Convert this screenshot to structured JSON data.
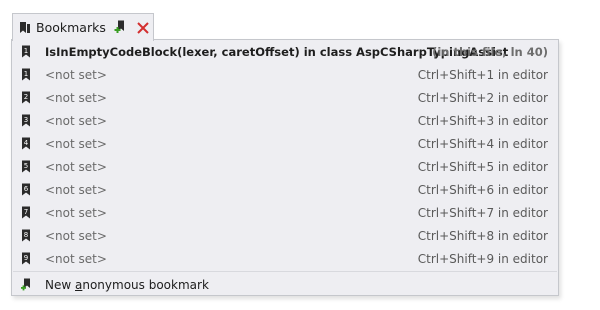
{
  "tab": {
    "title": "Bookmarks"
  },
  "current_bookmark": {
    "label": "IsInEmptyCodeBlock(lexer, caretOffset) in class AspCSharpTypingAssist",
    "location": "(in this file, ln 40)",
    "number": "1"
  },
  "bookmarks": [
    {
      "number": "1",
      "label": "<not set>",
      "shortcut": "Ctrl+Shift+1 in editor"
    },
    {
      "number": "2",
      "label": "<not set>",
      "shortcut": "Ctrl+Shift+2 in editor"
    },
    {
      "number": "3",
      "label": "<not set>",
      "shortcut": "Ctrl+Shift+3 in editor"
    },
    {
      "number": "4",
      "label": "<not set>",
      "shortcut": "Ctrl+Shift+4 in editor"
    },
    {
      "number": "5",
      "label": "<not set>",
      "shortcut": "Ctrl+Shift+5 in editor"
    },
    {
      "number": "6",
      "label": "<not set>",
      "shortcut": "Ctrl+Shift+6 in editor"
    },
    {
      "number": "7",
      "label": "<not set>",
      "shortcut": "Ctrl+Shift+7 in editor"
    },
    {
      "number": "8",
      "label": "<not set>",
      "shortcut": "Ctrl+Shift+8 in editor"
    },
    {
      "number": "9",
      "label": "<not set>",
      "shortcut": "Ctrl+Shift+9 in editor"
    }
  ],
  "new_bookmark": {
    "label_prefix": "New ",
    "label_accel": "a",
    "label_suffix": "nonymous bookmark"
  },
  "icons": {
    "bookmark": "bookmark-icon",
    "add": "add-bookmark-icon",
    "close": "close-icon"
  },
  "colors": {
    "close_red": "#d32f2f",
    "add_green": "#3a9d23",
    "icon_dark": "#2b2b2b"
  }
}
